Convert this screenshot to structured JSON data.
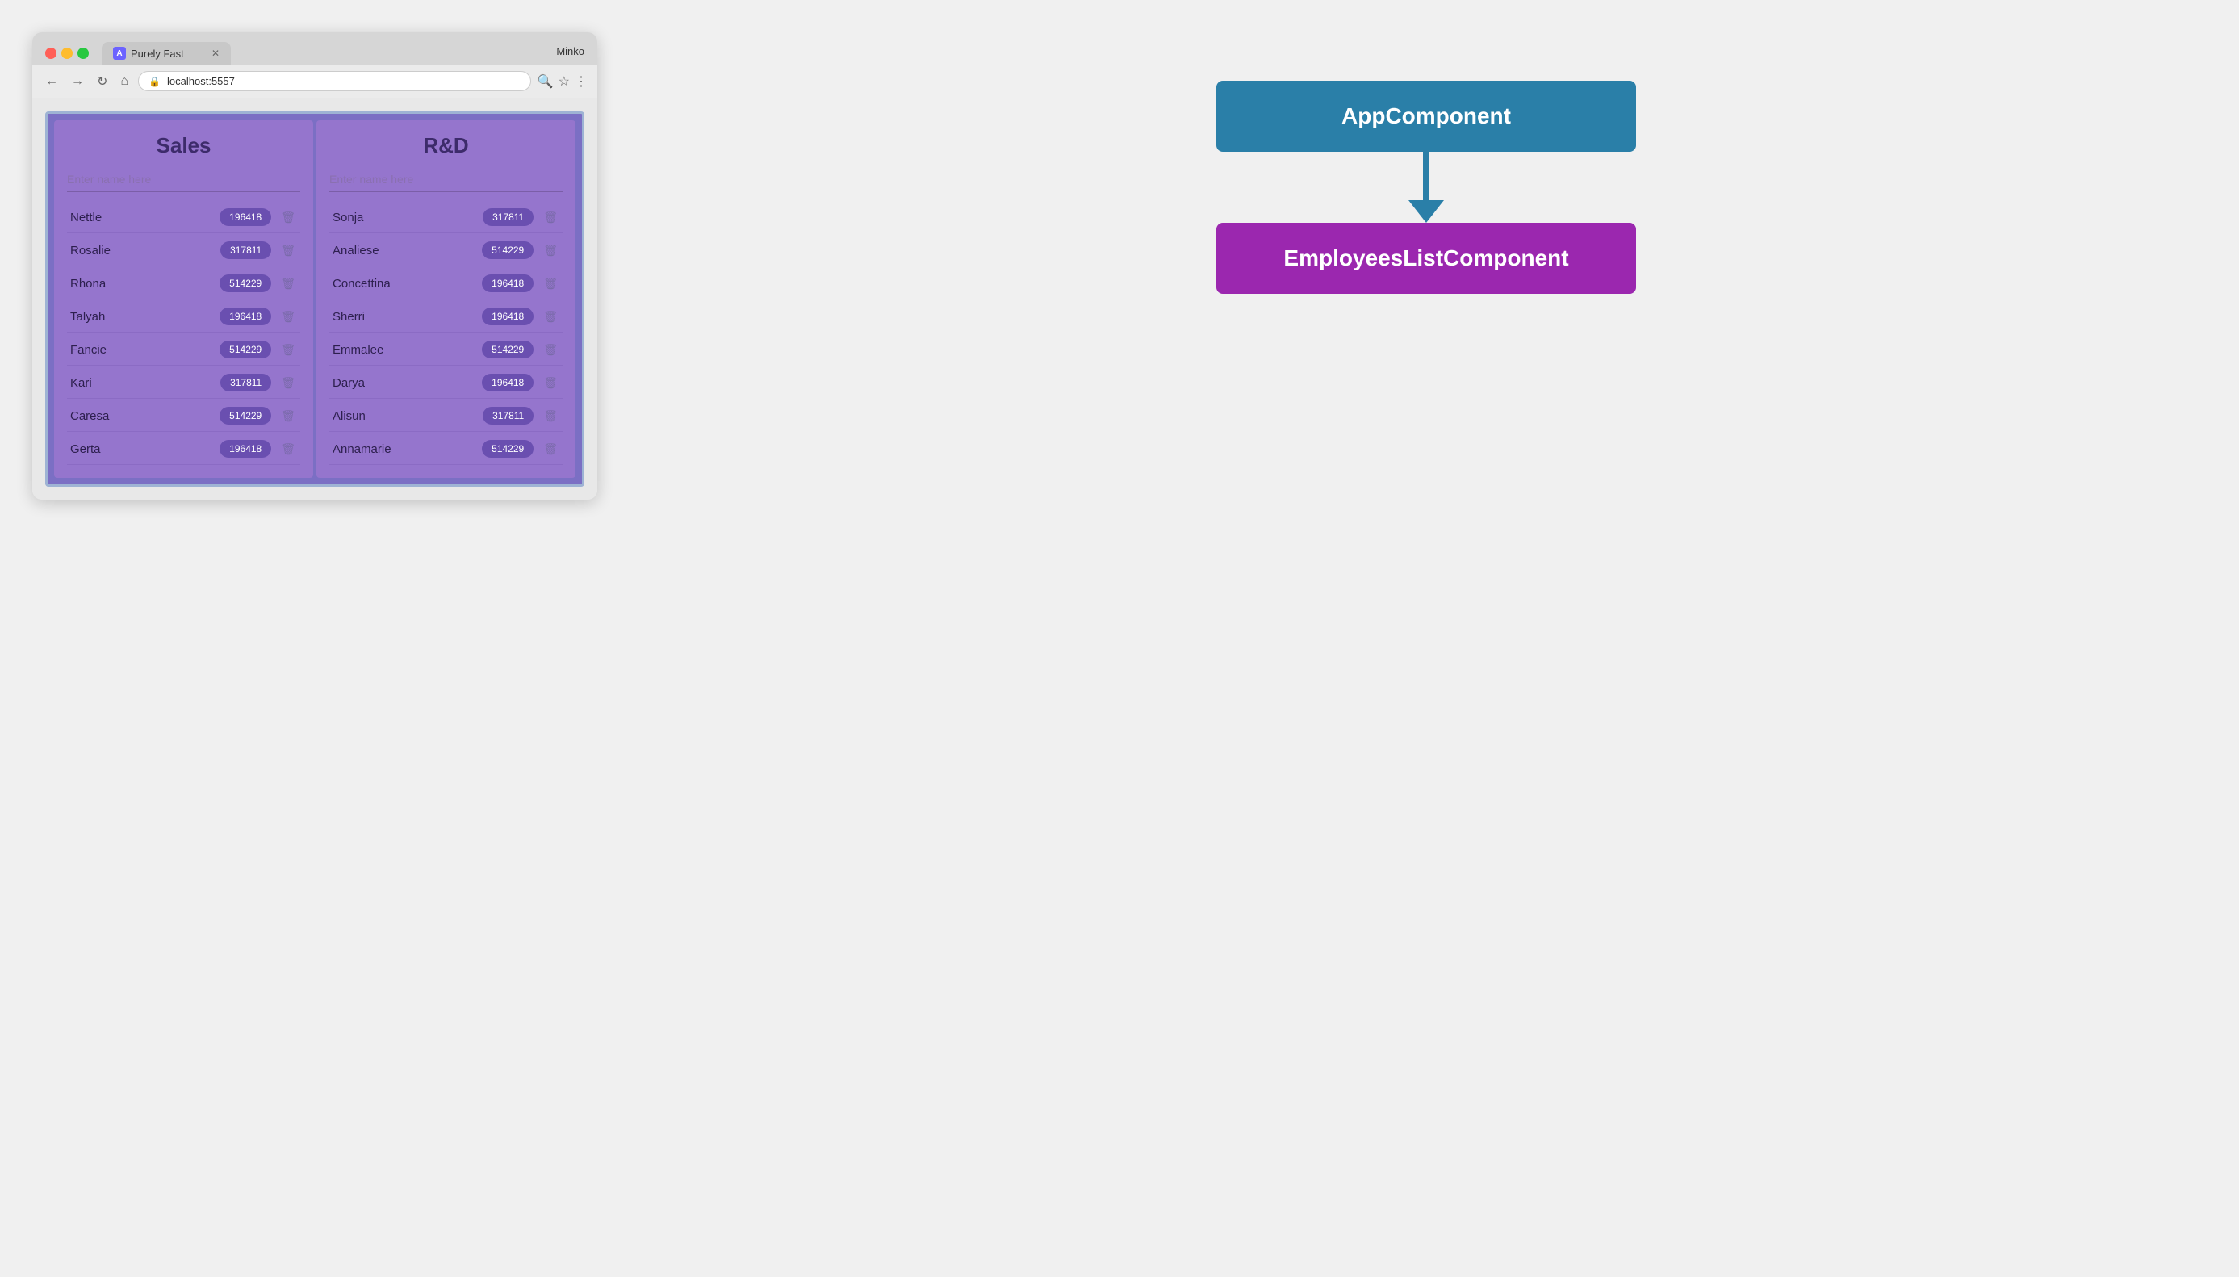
{
  "browser": {
    "tab_title": "Purely Fast",
    "url": "localhost:5557",
    "user": "Minko",
    "favicon_letter": "A",
    "back_btn": "←",
    "forward_btn": "→",
    "refresh_btn": "↻",
    "home_btn": "⌂"
  },
  "sales": {
    "title": "Sales",
    "placeholder": "Enter name here",
    "employees": [
      {
        "name": "Nettle",
        "id": "196418"
      },
      {
        "name": "Rosalie",
        "id": "317811"
      },
      {
        "name": "Rhona",
        "id": "514229"
      },
      {
        "name": "Talyah",
        "id": "196418"
      },
      {
        "name": "Fancie",
        "id": "514229"
      },
      {
        "name": "Kari",
        "id": "317811"
      },
      {
        "name": "Caresa",
        "id": "514229"
      },
      {
        "name": "Gerta",
        "id": "196418"
      }
    ]
  },
  "rnd": {
    "title": "R&D",
    "placeholder": "Enter name here",
    "employees": [
      {
        "name": "Sonja",
        "id": "317811"
      },
      {
        "name": "Analiese",
        "id": "514229"
      },
      {
        "name": "Concettina",
        "id": "196418"
      },
      {
        "name": "Sherri",
        "id": "196418"
      },
      {
        "name": "Emmalee",
        "id": "514229"
      },
      {
        "name": "Darya",
        "id": "196418"
      },
      {
        "name": "Alisun",
        "id": "317811"
      },
      {
        "name": "Annamarie",
        "id": "514229"
      }
    ]
  },
  "diagram": {
    "app_component_label": "AppComponent",
    "employees_component_label": "EmployeesListComponent"
  }
}
